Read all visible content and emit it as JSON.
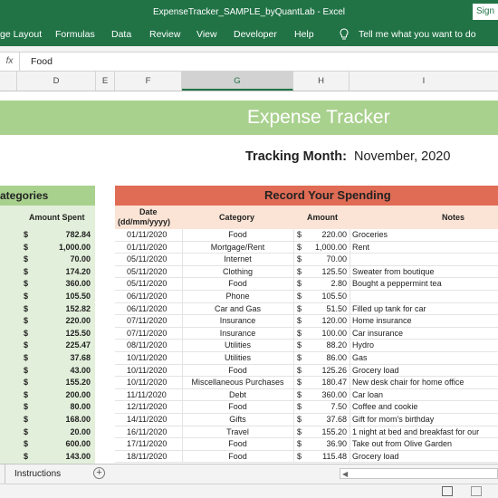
{
  "window": {
    "title": "ExpenseTracker_SAMPLE_byQuantLab  -  Excel",
    "signin": "Sign"
  },
  "ribbon": {
    "tabs": [
      "ge Layout",
      "Formulas",
      "Data",
      "Review",
      "View",
      "Developer",
      "Help"
    ],
    "tell_me": "Tell me what you want to do"
  },
  "formula_bar": {
    "fx": "fx",
    "value": "Food"
  },
  "columns": [
    "D",
    "E",
    "F",
    "G",
    "H",
    "I"
  ],
  "selected_column": "G",
  "sheet": {
    "title": "Expense Tracker",
    "tracking_label": "Tracking Month:",
    "tracking_value": "November, 2020",
    "categories_header": "ategories",
    "amount_spent_header": "Amount Spent",
    "record_header": "Record Your Spending",
    "col_date": "Date\n(dd/mm/yyyy)",
    "col_date_1": "Date",
    "col_date_2": "(dd/mm/yyyy)",
    "col_category": "Category",
    "col_amount": "Amount",
    "col_notes": "Notes",
    "currency": "$",
    "category_amounts": [
      "782.84",
      "1,000.00",
      "70.00",
      "174.20",
      "360.00",
      "105.50",
      "152.82",
      "220.00",
      "125.50",
      "225.47",
      "37.68",
      "43.00",
      "155.20",
      "200.00",
      "80.00",
      "168.00",
      "20.00",
      "600.00",
      "143.00"
    ],
    "entries": [
      {
        "date": "01/11/2020",
        "category": "Food",
        "amount": "220.00",
        "note": "Groceries"
      },
      {
        "date": "01/11/2020",
        "category": "Mortgage/Rent",
        "amount": "1,000.00",
        "note": "Rent"
      },
      {
        "date": "05/11/2020",
        "category": "Internet",
        "amount": "70.00",
        "note": ""
      },
      {
        "date": "05/11/2020",
        "category": "Clothing",
        "amount": "125.50",
        "note": "Sweater from boutique"
      },
      {
        "date": "05/11/2020",
        "category": "Food",
        "amount": "2.80",
        "note": "Bought a peppermint tea"
      },
      {
        "date": "06/11/2020",
        "category": "Phone",
        "amount": "105.50",
        "note": ""
      },
      {
        "date": "06/11/2020",
        "category": "Car and Gas",
        "amount": "51.50",
        "note": "Filled up tank for car"
      },
      {
        "date": "07/11/2020",
        "category": "Insurance",
        "amount": "120.00",
        "note": "Home insurance"
      },
      {
        "date": "07/11/2020",
        "category": "Insurance",
        "amount": "100.00",
        "note": "Car insurance"
      },
      {
        "date": "08/11/2020",
        "category": "Utilities",
        "amount": "88.20",
        "note": "Hydro"
      },
      {
        "date": "10/11/2020",
        "category": "Utilities",
        "amount": "86.00",
        "note": "Gas"
      },
      {
        "date": "10/11/2020",
        "category": "Food",
        "amount": "125.26",
        "note": "Grocery load"
      },
      {
        "date": "10/11/2020",
        "category": "Miscellaneous Purchases",
        "amount": "180.47",
        "note": "New desk chair for home office"
      },
      {
        "date": "11/11/2020",
        "category": "Debt",
        "amount": "360.00",
        "note": "Car loan"
      },
      {
        "date": "12/11/2020",
        "category": "Food",
        "amount": "7.50",
        "note": "Coffee and cookie"
      },
      {
        "date": "14/11/2020",
        "category": "Gifts",
        "amount": "37.68",
        "note": "Gift for mom's birthday"
      },
      {
        "date": "16/11/2020",
        "category": "Travel",
        "amount": "155.20",
        "note": "1 night at bed and breakfast for our"
      },
      {
        "date": "17/11/2020",
        "category": "Food",
        "amount": "36.90",
        "note": "Take out from Olive Garden"
      },
      {
        "date": "18/11/2020",
        "category": "Food",
        "amount": "115.48",
        "note": "Grocery load"
      }
    ]
  },
  "tabs": {
    "instructions": "Instructions",
    "add": "+"
  },
  "colors": {
    "excel_green": "#217346",
    "light_green": "#a9d18e",
    "pale_green": "#e2efda",
    "salmon": "#e06c55",
    "pale_peach": "#fbe4d5"
  }
}
